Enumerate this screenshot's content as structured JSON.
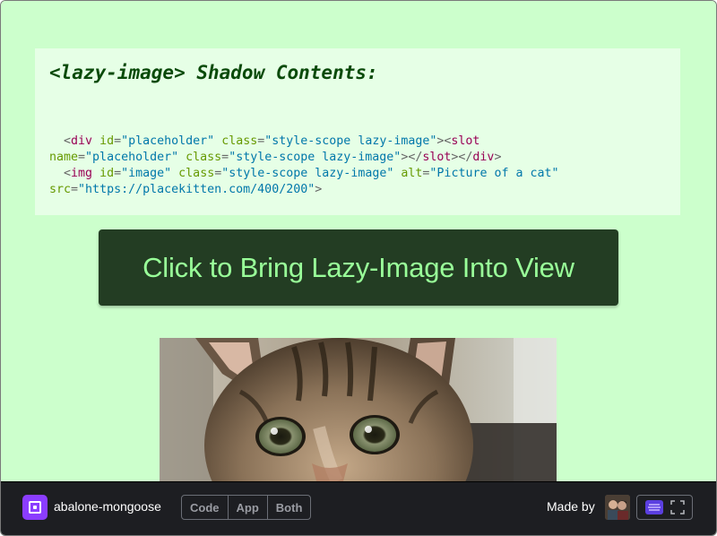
{
  "shadow": {
    "title": "<lazy-image> Shadow Contents:",
    "code": [
      [
        {
          "t": "  ",
          "c": "text"
        },
        {
          "t": "<",
          "c": "punc"
        },
        {
          "t": "div",
          "c": "tag"
        },
        {
          "t": " ",
          "c": "text"
        },
        {
          "t": "id",
          "c": "attr"
        },
        {
          "t": "=",
          "c": "punc"
        },
        {
          "t": "\"placeholder\"",
          "c": "str"
        },
        {
          "t": " ",
          "c": "text"
        },
        {
          "t": "class",
          "c": "attr"
        },
        {
          "t": "=",
          "c": "punc"
        },
        {
          "t": "\"style-scope lazy-image\"",
          "c": "str"
        },
        {
          "t": "><",
          "c": "punc"
        },
        {
          "t": "slot",
          "c": "tag"
        }
      ],
      [
        {
          "t": "name",
          "c": "attr"
        },
        {
          "t": "=",
          "c": "punc"
        },
        {
          "t": "\"placeholder\"",
          "c": "str"
        },
        {
          "t": " ",
          "c": "text"
        },
        {
          "t": "class",
          "c": "attr"
        },
        {
          "t": "=",
          "c": "punc"
        },
        {
          "t": "\"style-scope lazy-image\"",
          "c": "str"
        },
        {
          "t": "></",
          "c": "punc"
        },
        {
          "t": "slot",
          "c": "tag"
        },
        {
          "t": "></",
          "c": "punc"
        },
        {
          "t": "div",
          "c": "tag"
        },
        {
          "t": ">",
          "c": "punc"
        }
      ],
      [
        {
          "t": "  ",
          "c": "text"
        },
        {
          "t": "<",
          "c": "punc"
        },
        {
          "t": "img",
          "c": "tag"
        },
        {
          "t": " ",
          "c": "text"
        },
        {
          "t": "id",
          "c": "attr"
        },
        {
          "t": "=",
          "c": "punc"
        },
        {
          "t": "\"image\"",
          "c": "str"
        },
        {
          "t": " ",
          "c": "text"
        },
        {
          "t": "class",
          "c": "attr"
        },
        {
          "t": "=",
          "c": "punc"
        },
        {
          "t": "\"style-scope lazy-image\"",
          "c": "str"
        },
        {
          "t": " ",
          "c": "text"
        },
        {
          "t": "alt",
          "c": "attr"
        },
        {
          "t": "=",
          "c": "punc"
        },
        {
          "t": "\"Picture of a cat\"",
          "c": "str"
        }
      ],
      [
        {
          "t": "src",
          "c": "attr"
        },
        {
          "t": "=",
          "c": "punc"
        },
        {
          "t": "\"https://placekitten.com/400/200\"",
          "c": "str"
        },
        {
          "t": ">",
          "c": "punc"
        }
      ]
    ]
  },
  "main": {
    "button_label": "Click to Bring Lazy-Image Into View"
  },
  "footer": {
    "pen_name": "abalone-mongoose",
    "view_buttons": [
      "Code",
      "App",
      "Both"
    ],
    "made_by": "Made by"
  },
  "icons": {
    "pen_logo": "codepen-pen-icon",
    "cat": "cat-photo",
    "stack": "stack-icon",
    "expand": "expand-icon"
  },
  "colors": {
    "page_bg": "#ccffcc",
    "panel_bg": "#e6ffe6",
    "title": "#0a4a0a",
    "button_bg": "#233d23",
    "button_text": "#99ff99",
    "footer_bg": "#1d1e22",
    "logo_purple": "#8b3dff"
  }
}
